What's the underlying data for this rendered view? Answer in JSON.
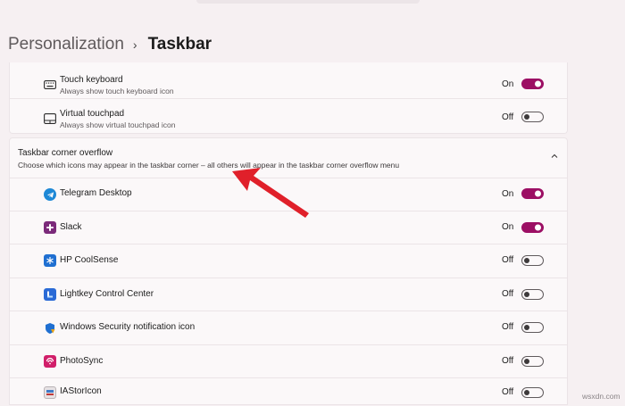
{
  "breadcrumb": {
    "parent": "Personalization",
    "separator": "›",
    "current": "Taskbar"
  },
  "system_items": [
    {
      "title": "Touch keyboard",
      "subtitle": "Always show touch keyboard icon",
      "state": "On",
      "on": true,
      "icon": "keyboard-icon"
    },
    {
      "title": "Virtual touchpad",
      "subtitle": "Always show virtual touchpad icon",
      "state": "Off",
      "on": false,
      "icon": "touchpad-icon"
    }
  ],
  "overflow": {
    "title": "Taskbar corner overflow",
    "description": "Choose which icons may appear in the taskbar corner – all others will appear in the taskbar corner overflow menu",
    "expanded": true,
    "apps": [
      {
        "name": "Telegram Desktop",
        "state": "On",
        "on": true,
        "icon": "telegram-icon"
      },
      {
        "name": "Slack",
        "state": "On",
        "on": true,
        "icon": "slack-icon"
      },
      {
        "name": "HP CoolSense",
        "state": "Off",
        "on": false,
        "icon": "hp-coolsense-icon"
      },
      {
        "name": "Lightkey Control Center",
        "state": "Off",
        "on": false,
        "icon": "lightkey-icon"
      },
      {
        "name": "Windows Security notification icon",
        "state": "Off",
        "on": false,
        "icon": "windows-security-icon"
      },
      {
        "name": "PhotoSync",
        "state": "Off",
        "on": false,
        "icon": "photosync-icon"
      },
      {
        "name": "IAStorIcon",
        "state": "Off",
        "on": false,
        "icon": "iastor-icon"
      }
    ]
  },
  "colors": {
    "accent": "#9c0f64",
    "background": "#f6f0f2",
    "card": "#fbf8f9",
    "annotation_arrow": "#e0202a"
  },
  "watermark": "wsxdn.com"
}
